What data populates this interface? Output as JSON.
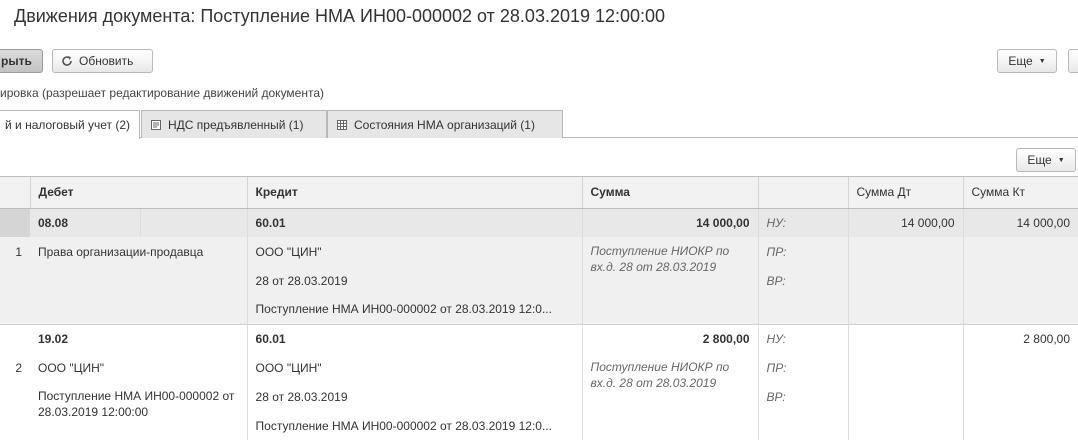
{
  "title": "Движения документа: Поступление НМА ИН00-000002 от 28.03.2019 12:00:00",
  "toolbar": {
    "close_label": "рыть",
    "refresh_label": "Обновить",
    "more_label": "Еще"
  },
  "note": "ировка (разрешает редактирование движений документа)",
  "tabs": [
    {
      "label": "й и налоговый учет (2)"
    },
    {
      "label": "НДС предъявленный (1)"
    },
    {
      "label": "Состояния НМА организаций (1)"
    }
  ],
  "table_more_label": "Еще",
  "columns": {
    "debet": "Дебет",
    "kredit": "Кредит",
    "summa": "Сумма",
    "summa_dt": "Сумма Дт",
    "summa_kt": "Сумма Кт"
  },
  "rows": [
    {
      "num": "1",
      "debet_account": "08.08",
      "debet_sub1": "Права организации-продавца",
      "debet_sub2": "",
      "kredit_account": "60.01",
      "kredit_sub1": "ООО \"ЦИН\"",
      "kredit_sub2": "28 от 28.03.2019",
      "kredit_sub3": "Поступление НМА ИН00-000002 от 28.03.2019 12:0...",
      "summa": "14 000,00",
      "content": "Поступление НИОКР по вх.д. 28 от 28.03.2019",
      "nu": "НУ:",
      "pr": "ПР:",
      "vr": "ВР:",
      "nu_dt": "14 000,00",
      "nu_kt": "14 000,00"
    },
    {
      "num": "2",
      "debet_account": "19.02",
      "debet_sub1": "ООО \"ЦИН\"",
      "debet_sub2": "Поступление НМА ИН00-000002 от 28.03.2019 12:00:00",
      "kredit_account": "60.01",
      "kredit_sub1": "ООО \"ЦИН\"",
      "kredit_sub2": "28 от 28.03.2019",
      "kredit_sub3": "Поступление НМА ИН00-000002 от 28.03.2019 12:0...",
      "summa": "2 800,00",
      "content": "Поступление НИОКР по вх.д. 28 от 28.03.2019",
      "nu": "НУ:",
      "pr": "ПР:",
      "vr": "ВР:",
      "nu_dt": "",
      "nu_kt": "2 800,00"
    }
  ]
}
